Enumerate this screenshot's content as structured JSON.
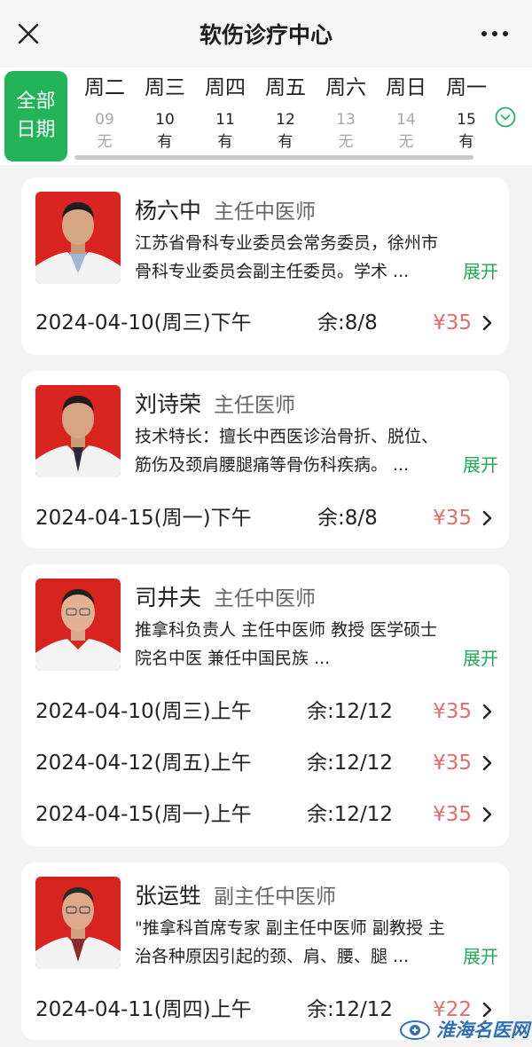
{
  "header": {
    "title": "软伤诊疗中心"
  },
  "date_bar": {
    "all_dates_line1": "全部",
    "all_dates_line2": "日期",
    "days": [
      {
        "weekday": "周二",
        "date": "09",
        "status": "无",
        "available": false
      },
      {
        "weekday": "周三",
        "date": "10",
        "status": "有",
        "available": true
      },
      {
        "weekday": "周四",
        "date": "11",
        "status": "有",
        "available": true
      },
      {
        "weekday": "周五",
        "date": "12",
        "status": "有",
        "available": true
      },
      {
        "weekday": "周六",
        "date": "13",
        "status": "无",
        "available": false
      },
      {
        "weekday": "周日",
        "date": "14",
        "status": "无",
        "available": false
      },
      {
        "weekday": "周一",
        "date": "15",
        "status": "有",
        "available": true
      }
    ]
  },
  "expand_label": "展开",
  "doctors": [
    {
      "name": "杨六中",
      "title": "主任中医师",
      "bio_line1": "江苏省骨科专业委员会常务委员，徐州市",
      "bio_line2": "骨科专业委员会副主任委员。学术 ...",
      "slots": [
        {
          "date": "2024-04-10(周三)下午",
          "remaining": "余:8/8",
          "price": "¥35"
        }
      ]
    },
    {
      "name": "刘诗荣",
      "title": "主任医师",
      "bio_line1": "技术特长：擅长中西医诊治骨折、脱位、",
      "bio_line2": "筋伤及颈肩腰腿痛等骨伤科疾病。 ...",
      "slots": [
        {
          "date": "2024-04-15(周一)下午",
          "remaining": "余:8/8",
          "price": "¥35"
        }
      ]
    },
    {
      "name": "司井夫",
      "title": "主任中医师",
      "bio_line1": "推拿科负责人 主任中医师 教授 医学硕士",
      "bio_line2": "院名中医 兼任中国民族 ...",
      "slots": [
        {
          "date": "2024-04-10(周三)上午",
          "remaining": "余:12/12",
          "price": "¥35"
        },
        {
          "date": "2024-04-12(周五)上午",
          "remaining": "余:12/12",
          "price": "¥35"
        },
        {
          "date": "2024-04-15(周一)上午",
          "remaining": "余:12/12",
          "price": "¥35"
        }
      ]
    },
    {
      "name": "张运甡",
      "title": "副主任中医师",
      "bio_line1": "\"推拿科首席专家 副主任中医师 副教授 主",
      "bio_line2": "治各种原因引起的颈、肩、腰、腿 ...",
      "slots": [
        {
          "date": "2024-04-11(周四)上午",
          "remaining": "余:12/12",
          "price": "¥22"
        }
      ]
    }
  ],
  "watermark": {
    "text": "淮海名医网"
  },
  "colors": {
    "accent_green": "#23b45a",
    "price_red": "#e46c6c",
    "photo_background": "#d8231f"
  }
}
